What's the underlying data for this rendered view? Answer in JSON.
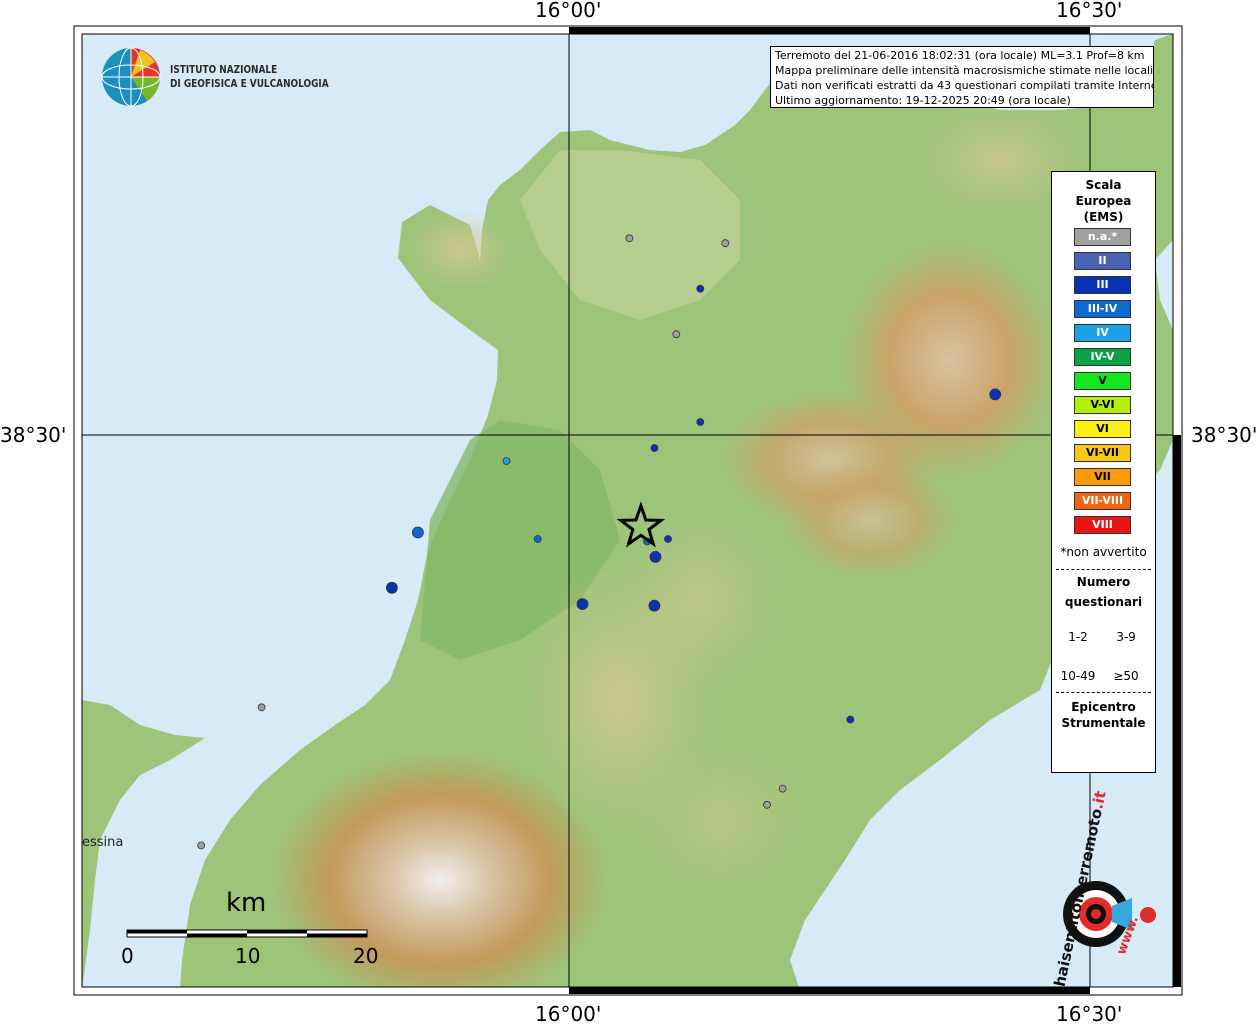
{
  "coordinates": {
    "top_left": "16°00'",
    "top_right": "16°30'",
    "bottom_left": "16°00'",
    "bottom_right": "16°30'",
    "left_lat": "38°30'",
    "right_lat": "38°30'"
  },
  "info": {
    "line1": "Terremoto del 21-06-2016 18:02:31 (ora locale) ML=3.1 Prof=8 km",
    "line2": "Mappa preliminare delle intensità macrosismiche stimate nelle località",
    "line3": "Dati non verificati estratti da 43 questionari compilati tramite Internet.",
    "line4": "Ultimo aggiornamento: 19-12-2025 20:49 (ora locale)"
  },
  "logo": {
    "line1": "ISTITUTO NAZIONALE",
    "line2": "DI GEOFISICA E VULCANOLOGIA"
  },
  "legend": {
    "title_line1": "Scala",
    "title_line2": "Europea",
    "title_line3": "(EMS)",
    "classes": [
      {
        "label": "n.a.*",
        "color": "#a0a0a0",
        "text": "#ffffff"
      },
      {
        "label": "II",
        "color": "#4a63b0",
        "text": "#ffffff"
      },
      {
        "label": "III",
        "color": "#0a32b4",
        "text": "#ffffff"
      },
      {
        "label": "III-IV",
        "color": "#0f69d2",
        "text": "#ffffff"
      },
      {
        "label": "IV",
        "color": "#1ea0e6",
        "text": "#ffffff"
      },
      {
        "label": "IV-V",
        "color": "#0aa046",
        "text": "#ffffff"
      },
      {
        "label": "V",
        "color": "#14e61e",
        "text": "#000000"
      },
      {
        "label": "V-VI",
        "color": "#b4f00a",
        "text": "#000000"
      },
      {
        "label": "VI",
        "color": "#faf014",
        "text": "#000000"
      },
      {
        "label": "VI-VII",
        "color": "#fac814",
        "text": "#000000"
      },
      {
        "label": "VII",
        "color": "#fa9b0a",
        "text": "#000000"
      },
      {
        "label": "VII-VIII",
        "color": "#f06414",
        "text": "#ffffff"
      },
      {
        "label": "VIII",
        "color": "#eb1414",
        "text": "#ffffff"
      }
    ],
    "not_felt": "*non avvertito",
    "count_title_line1": "Numero",
    "count_title_line2": "questionari",
    "size_labels": [
      "1-2",
      "3-9",
      "10-49",
      "≥50"
    ],
    "epicenter_line1": "Epicentro",
    "epicenter_line2": "Strumentale"
  },
  "scale_bar": {
    "unit": "km",
    "ticks": [
      "0",
      "10",
      "20"
    ]
  },
  "place_label": "essina",
  "brand": {
    "text1": "haisentitoilterremoto",
    "text2": ".it",
    "url": "www."
  },
  "colors": {
    "sea": "#d6ebf7",
    "coast_lowland": "#8fbf6c",
    "epicenter_star": "#000000"
  },
  "points": [
    {
      "lat": 38.742,
      "lon": 16.058,
      "cls": "n.a.*",
      "size": "1-2"
    },
    {
      "lat": 38.736,
      "lon": 16.15,
      "cls": "n.a.*",
      "size": "1-2"
    },
    {
      "lat": 38.68,
      "lon": 16.126,
      "cls": "III",
      "size": "1-2"
    },
    {
      "lat": 38.624,
      "lon": 16.103,
      "cls": "n.a.*",
      "size": "1-2"
    },
    {
      "lat": 38.55,
      "lon": 16.409,
      "cls": "III",
      "size": "3-9"
    },
    {
      "lat": 38.516,
      "lon": 16.126,
      "cls": "III",
      "size": "1-2"
    },
    {
      "lat": 38.484,
      "lon": 16.082,
      "cls": "III",
      "size": "1-2"
    },
    {
      "lat": 38.468,
      "lon": 15.94,
      "cls": "IV",
      "size": "1-2"
    },
    {
      "lat": 38.38,
      "lon": 15.855,
      "cls": "III-IV",
      "size": "3-9"
    },
    {
      "lat": 38.372,
      "lon": 15.97,
      "cls": "III-IV",
      "size": "1-2"
    },
    {
      "lat": 38.372,
      "lon": 16.095,
      "cls": "III",
      "size": "1-2"
    },
    {
      "lat": 38.369,
      "lon": 16.075,
      "cls": "III-IV",
      "size": "1-2"
    },
    {
      "lat": 38.35,
      "lon": 16.083,
      "cls": "III",
      "size": "3-9"
    },
    {
      "lat": 38.312,
      "lon": 15.83,
      "cls": "III",
      "size": "3-9"
    },
    {
      "lat": 38.292,
      "lon": 16.013,
      "cls": "III",
      "size": "3-9"
    },
    {
      "lat": 38.29,
      "lon": 16.082,
      "cls": "III",
      "size": "3-9"
    },
    {
      "lat": 38.165,
      "lon": 15.705,
      "cls": "n.a.*",
      "size": "1-2"
    },
    {
      "lat": 38.15,
      "lon": 16.27,
      "cls": "III",
      "size": "1-2"
    },
    {
      "lat": 38.065,
      "lon": 16.205,
      "cls": "n.a.*",
      "size": "1-2"
    },
    {
      "lat": 38.045,
      "lon": 16.19,
      "cls": "n.a.*",
      "size": "1-2"
    },
    {
      "lat": 37.995,
      "lon": 15.647,
      "cls": "n.a.*",
      "size": "1-2"
    }
  ],
  "epicenter": {
    "lat": 38.387,
    "lon": 16.069
  }
}
